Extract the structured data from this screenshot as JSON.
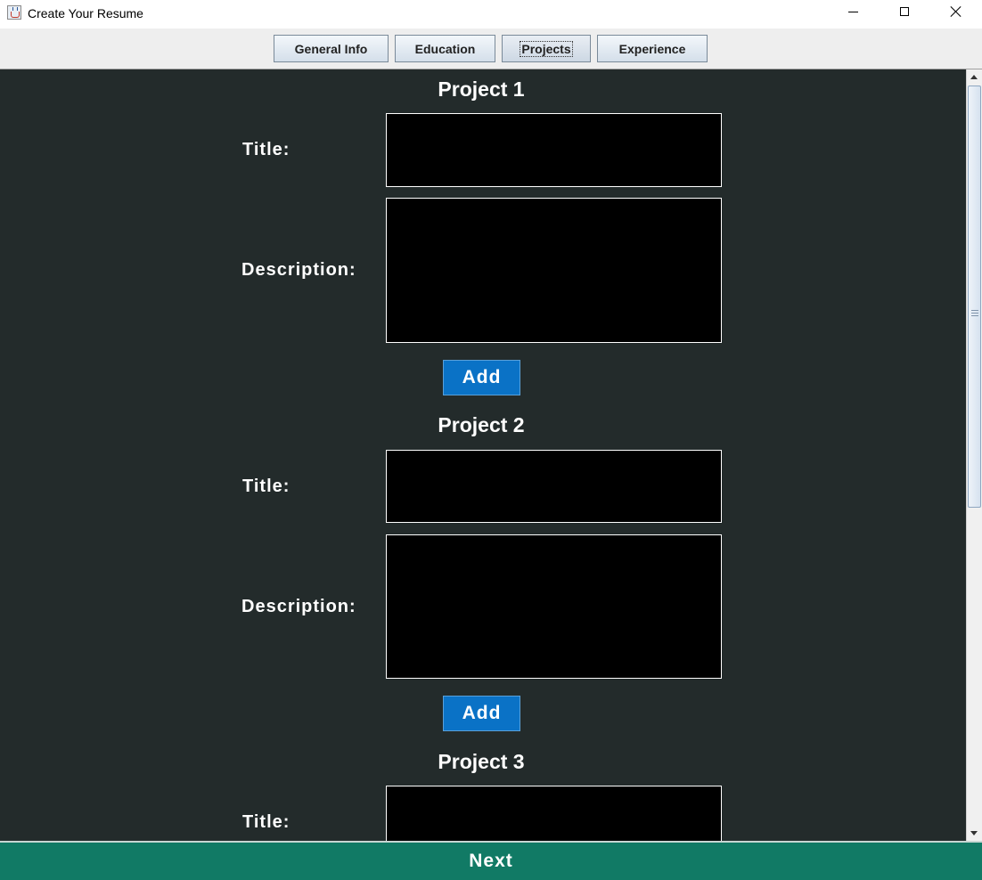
{
  "window": {
    "title": "Create Your Resume"
  },
  "tabs": [
    {
      "label": "General Info"
    },
    {
      "label": "Education"
    },
    {
      "label": "Projects",
      "active": true
    },
    {
      "label": "Experience"
    }
  ],
  "projects": [
    {
      "heading": "Project 1",
      "title_label": "Title:",
      "description_label": "Description:",
      "title_value": "",
      "description_value": "",
      "add_label": "Add"
    },
    {
      "heading": "Project 2",
      "title_label": "Title:",
      "description_label": "Description:",
      "title_value": "",
      "description_value": "",
      "add_label": "Add"
    },
    {
      "heading": "Project 3",
      "title_label": "Title:",
      "title_value": ""
    }
  ],
  "footer": {
    "next_label": "Next"
  },
  "colors": {
    "content_bg": "#232b2b",
    "field_bg": "#000000",
    "add_button": "#0a72c6",
    "next_bar": "#117a65"
  }
}
